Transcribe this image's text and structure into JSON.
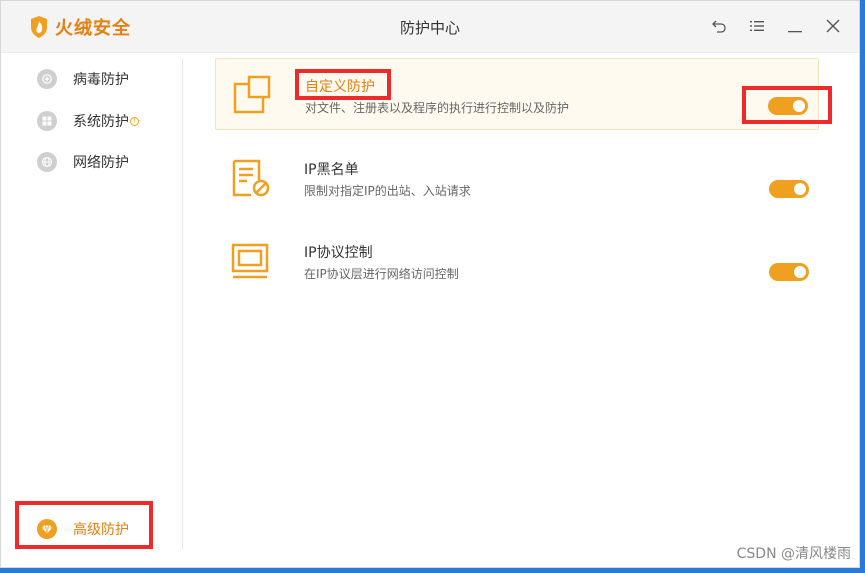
{
  "app": {
    "brand": "火绒安全",
    "window_title": "防护中心"
  },
  "window_controls": [
    {
      "name": "back-icon"
    },
    {
      "name": "menu-icon"
    },
    {
      "name": "minimize-icon"
    },
    {
      "name": "close-icon"
    }
  ],
  "sidebar": {
    "items": [
      {
        "label": "病毒防护",
        "icon": "plus-icon"
      },
      {
        "label": "系统防护",
        "icon": "windows-icon",
        "badge": "!"
      },
      {
        "label": "网络防护",
        "icon": "globe-icon"
      }
    ],
    "advanced": {
      "label": "高级防护",
      "icon": "gem-icon"
    }
  },
  "rows": [
    {
      "title": "自定义防护",
      "desc": "对文件、注册表以及程序的执行进行控制以及防护",
      "enabled": true
    },
    {
      "title": "IP黑名单",
      "desc": "限制对指定IP的出站、入站请求",
      "enabled": true
    },
    {
      "title": "IP协议控制",
      "desc": "在IP协议层进行网络访问控制",
      "enabled": true
    }
  ],
  "colors": {
    "accent": "#f0a020",
    "brand": "#e67e10",
    "highlight_border": "#ee2a2a"
  },
  "watermark": "CSDN @清风楼雨"
}
